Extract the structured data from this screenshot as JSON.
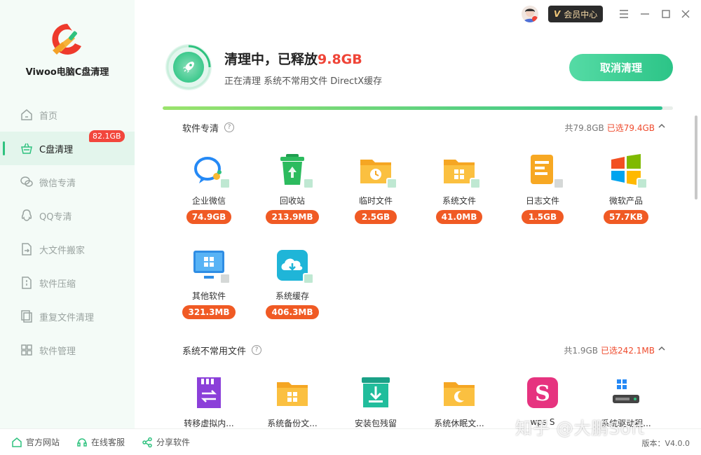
{
  "app": {
    "name": "Viwoo电脑C盘清理"
  },
  "sidebar": {
    "items": [
      {
        "label": "首页",
        "icon": "home-icon",
        "active": false
      },
      {
        "label": "C盘清理",
        "icon": "broom-basket-icon",
        "active": true,
        "badge": "82.1GB"
      },
      {
        "label": "微信专清",
        "icon": "wechat-icon",
        "active": false
      },
      {
        "label": "QQ专清",
        "icon": "qq-icon",
        "active": false
      },
      {
        "label": "大文件搬家",
        "icon": "file-move-icon",
        "active": false
      },
      {
        "label": "软件压缩",
        "icon": "compress-icon",
        "active": false
      },
      {
        "label": "重复文件清理",
        "icon": "duplicate-file-icon",
        "active": false
      },
      {
        "label": "软件管理",
        "icon": "apps-grid-icon",
        "active": false
      }
    ]
  },
  "topbar": {
    "vip_label": "会员中心"
  },
  "status": {
    "title_prefix": "清理中，已释放",
    "freed": "9.8GB",
    "subtitle": "正在清理 系统不常用文件 DirectX缓存",
    "cancel_label": "取消清理",
    "progress": 0.98
  },
  "sections": [
    {
      "title": "软件专清",
      "total": "共79.8GB",
      "selected": "已选79.4GB",
      "items": [
        {
          "name": "企业微信",
          "size": "74.9GB",
          "icon": "wecom-icon"
        },
        {
          "name": "回收站",
          "size": "213.9MB",
          "icon": "recycle-bin-icon"
        },
        {
          "name": "临时文件",
          "size": "2.5GB",
          "icon": "temp-folder-icon"
        },
        {
          "name": "系统文件",
          "size": "41.0MB",
          "icon": "system-folder-icon"
        },
        {
          "name": "日志文件",
          "size": "1.5GB",
          "icon": "log-file-icon"
        },
        {
          "name": "微软产品",
          "size": "57.7KB",
          "icon": "windows-logo-icon"
        },
        {
          "name": "其他软件",
          "size": "321.3MB",
          "icon": "monitor-apps-icon"
        },
        {
          "name": "系统缓存",
          "size": "406.3MB",
          "icon": "cloud-download-icon"
        }
      ]
    },
    {
      "title": "系统不常用文件",
      "total": "共1.9GB",
      "selected": "已选242.1MB",
      "items": [
        {
          "name": "转移虚拟内...",
          "icon": "memory-transfer-icon"
        },
        {
          "name": "系统备份文...",
          "icon": "backup-folder-icon"
        },
        {
          "name": "安装包残留",
          "icon": "install-package-icon"
        },
        {
          "name": "系统休眠文...",
          "icon": "sleep-folder-icon"
        },
        {
          "name": "wps S",
          "icon": "wps-icon"
        },
        {
          "name": "系统驱动程...",
          "icon": "driver-icon"
        }
      ]
    }
  ],
  "footer": {
    "links": [
      "官方网站",
      "在线客服",
      "分享软件"
    ],
    "version": "版本：V4.0.0"
  },
  "watermark": "知乎 @大鹏Soft",
  "colors": {
    "accent": "#2fc27f",
    "badge": "#f05a24",
    "highlight": "#ef4437",
    "sidebar_bg": "#f4fbf7"
  }
}
